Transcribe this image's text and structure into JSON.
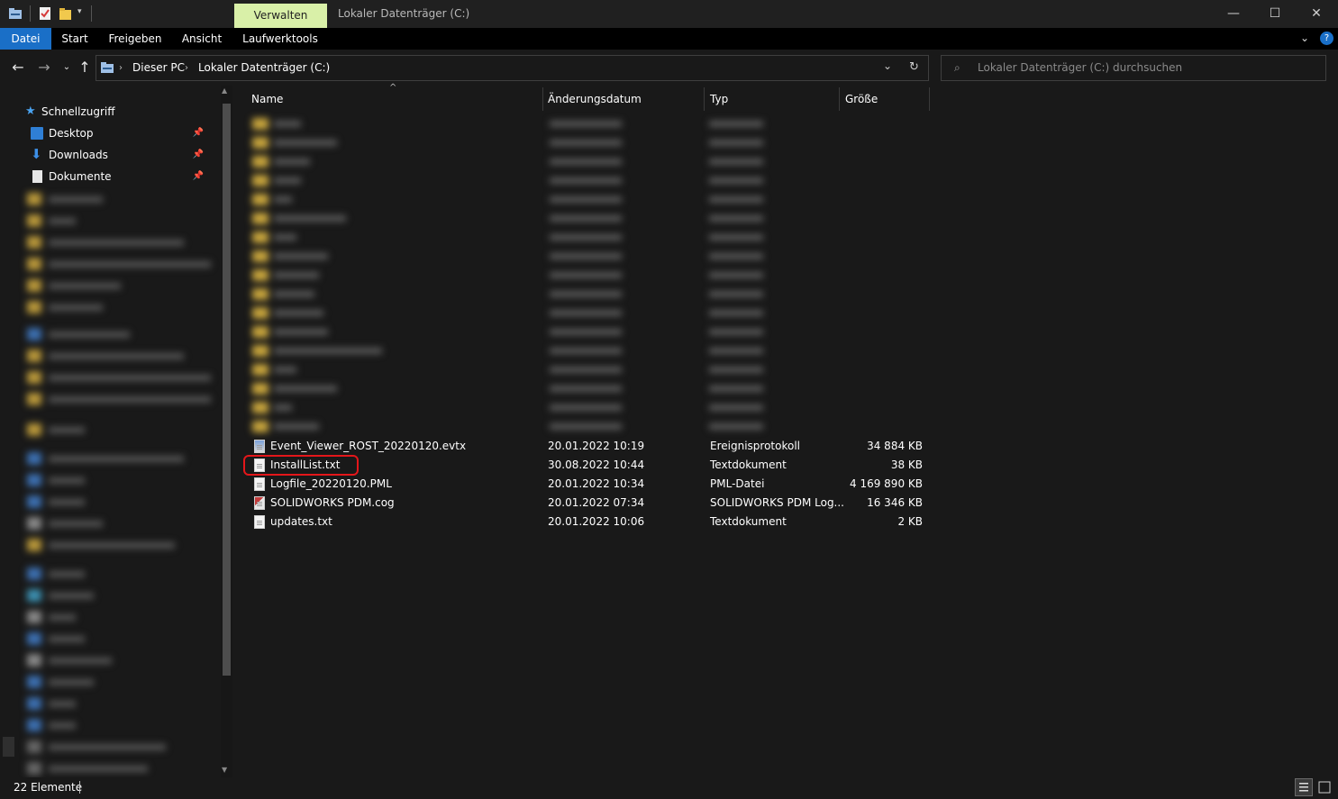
{
  "titlebar": {
    "context_tab": "Verwalten",
    "window_title": "Lokaler Datenträger (C:)",
    "minimize": "—",
    "maximize": "☐",
    "close": "✕"
  },
  "ribbon": {
    "tabs": [
      "Datei",
      "Start",
      "Freigeben",
      "Ansicht",
      "Laufwerktools"
    ]
  },
  "address": {
    "crumbs": [
      "Dieser PC",
      "Lokaler Datenträger (C:)"
    ],
    "search_placeholder": "Lokaler Datenträger (C:) durchsuchen"
  },
  "navpane": {
    "quick_access": "Schnellzugriff",
    "items": [
      {
        "label": "Desktop",
        "icon": "desktop-icon"
      },
      {
        "label": "Downloads",
        "icon": "download-arrow-icon"
      },
      {
        "label": "Dokumente",
        "icon": "document-icon"
      }
    ]
  },
  "columns": [
    "Name",
    "Änderungsdatum",
    "Typ",
    "Größe"
  ],
  "files": [
    {
      "name": "Event_Viewer_ROST_20220120.evtx",
      "date": "20.01.2022 10:19",
      "type": "Ereignisprotokoll",
      "size": "34 884 KB",
      "icon": "evtx"
    },
    {
      "name": "InstallList.txt",
      "date": "30.08.2022 10:44",
      "type": "Textdokument",
      "size": "38 KB",
      "icon": "txt"
    },
    {
      "name": "Logfile_20220120.PML",
      "date": "20.01.2022 10:34",
      "type": "PML-Datei",
      "size": "4 169 890 KB",
      "icon": "txt"
    },
    {
      "name": "SOLIDWORKS PDM.cog",
      "date": "20.01.2022 07:34",
      "type": "SOLIDWORKS PDM Log...",
      "size": "16 346 KB",
      "icon": "cog"
    },
    {
      "name": "updates.txt",
      "date": "20.01.2022 10:06",
      "type": "Textdokument",
      "size": "2 KB",
      "icon": "txt"
    }
  ],
  "status": {
    "item_count": "22 Elemente"
  },
  "colors": {
    "accent": "#1a6fc7",
    "context_tab": "#d9f0a8",
    "highlight": "#e4161a"
  }
}
